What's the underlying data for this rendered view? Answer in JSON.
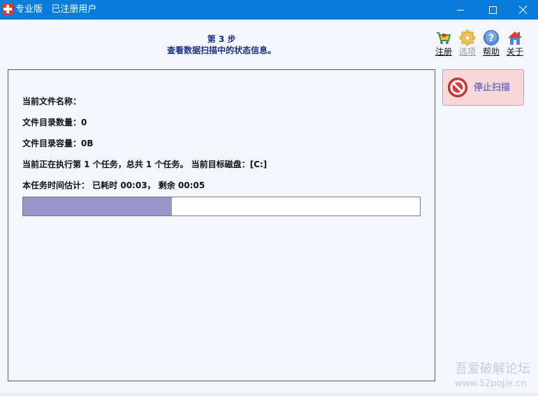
{
  "window": {
    "title": "专业版   已注册用户"
  },
  "header": {
    "step_title": "第 3 步",
    "step_desc": "查看数据扫描中的状态信息。"
  },
  "toolbar": {
    "items": [
      {
        "label": "注册",
        "icon": "cart-icon",
        "enabled": true
      },
      {
        "label": "选项",
        "icon": "gear-icon",
        "enabled": false
      },
      {
        "label": "帮助",
        "icon": "help-icon",
        "enabled": true
      },
      {
        "label": "关于",
        "icon": "house-icon",
        "enabled": true
      }
    ]
  },
  "status": {
    "current_file_label": "当前文件名称：",
    "current_file_value": "",
    "dir_count_label": "文件目录数量：",
    "dir_count_value": "0",
    "dir_size_label": "文件目录容量：",
    "dir_size_value": "0B",
    "task_text": "当前正在执行第 1 个任务，总共 1 个任务。 当前目标磁盘：[C:]",
    "time_text": "本任务时间估计：  已耗时 00:03，  剩余 00:05",
    "progress_fraction": 0.375
  },
  "actions": {
    "stop_label": "停止扫描"
  },
  "watermark": {
    "line1": "吾爱破解论坛",
    "line2": "www.52pojie.cn"
  },
  "colors": {
    "titlebar": "#0a7cd9",
    "header_text": "#1c2f86",
    "progress_fill": "#9796cb",
    "stop_button_bg": "#f7d9da",
    "stop_button_text": "#7a73c9"
  }
}
